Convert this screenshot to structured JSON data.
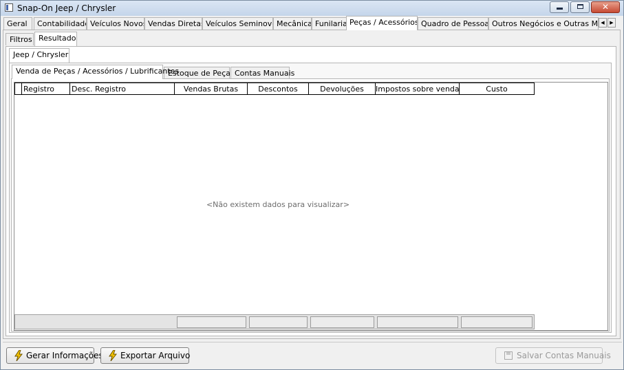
{
  "window": {
    "title": "Snap-On Jeep / Chrysler",
    "min_label": "",
    "max_label": "",
    "close_label": "✕"
  },
  "top_tabs": [
    "Geral",
    "Contabilidade",
    "Veículos Novos",
    "Vendas Diretas",
    "Veículos Seminovos",
    "Mecânica",
    "Funilaria",
    "Peças / Acessórios",
    "Quadro de Pessoas",
    "Outros Negócios e Outras Marc"
  ],
  "top_tab_active": "Peças / Acessórios",
  "scroll": {
    "left": "◀",
    "right": "▶"
  },
  "view_tabs": [
    "Filtros",
    "Resultado"
  ],
  "view_tab_active": "Resultado",
  "brand_tabs": [
    "Jeep / Chrysler"
  ],
  "section_tabs": [
    "Venda de Peças / Acessórios / Lubrificantes",
    "Estoque de Peças",
    "Contas Manuais"
  ],
  "section_tab_active": "Venda de Peças / Acessórios / Lubrificantes",
  "grid": {
    "columns": [
      "Registro",
      "Desc. Registro",
      "Vendas Brutas",
      "Descontos",
      "Devoluções",
      "Impostos sobre vendas",
      "Custo"
    ],
    "empty_message": "<Não existem dados para visualizar>"
  },
  "buttons": {
    "gerar": "Gerar Informações",
    "exportar": "Exportar Arquivo",
    "salvar": "Salvar Contas Manuais"
  },
  "colors": {
    "accent_bolt": "#f2c200",
    "title_bar": "#c4d5ea"
  }
}
